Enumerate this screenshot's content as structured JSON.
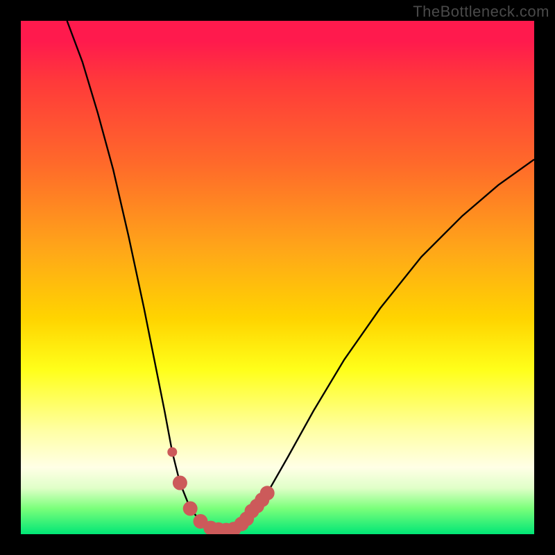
{
  "watermark": {
    "text": "TheBottleneck.com"
  },
  "colors": {
    "frame": "#000000",
    "curve_stroke": "#000000",
    "marker_stroke": "#cc5a5a",
    "marker_fill": "#cc5a5a",
    "gradient_stops": [
      {
        "stop": 0.0,
        "hex": "#ff1a4d"
      },
      {
        "stop": 0.28,
        "hex": "#ff6a2a"
      },
      {
        "stop": 0.58,
        "hex": "#ffd400"
      },
      {
        "stop": 0.8,
        "hex": "#ffffa6"
      },
      {
        "stop": 0.91,
        "hex": "#e0ffc8"
      },
      {
        "stop": 1.0,
        "hex": "#00e676"
      }
    ]
  },
  "chart_data": {
    "type": "line",
    "title": "",
    "xlabel": "",
    "ylabel": "",
    "xlim": [
      0,
      100
    ],
    "ylim": [
      0,
      100
    ],
    "grid": false,
    "series": [
      {
        "name": "curve-left",
        "x": [
          9,
          12,
          15,
          18,
          21,
          24,
          26,
          28,
          29.5,
          31,
          33,
          35,
          37,
          40
        ],
        "y": [
          100,
          92,
          82,
          71,
          58,
          44,
          34,
          24,
          16,
          10,
          5,
          2.5,
          1.2,
          0.8
        ]
      },
      {
        "name": "curve-right",
        "x": [
          40,
          44,
          48,
          52,
          57,
          63,
          70,
          78,
          86,
          93,
          100
        ],
        "y": [
          0.8,
          3,
          8,
          15,
          24,
          34,
          44,
          54,
          62,
          68,
          73
        ]
      }
    ],
    "markers": {
      "name": "highlight-near-minimum",
      "x": [
        29.5,
        31,
        33,
        35,
        37,
        38.5,
        40,
        41.5,
        43,
        44,
        45,
        46,
        47,
        48
      ],
      "y": [
        16,
        10,
        5,
        2.5,
        1.2,
        0.9,
        0.8,
        1.0,
        2.0,
        3.0,
        4.5,
        5.5,
        6.7,
        8
      ]
    },
    "gradient_meaning": "top=red=bad, bottom=green=good"
  }
}
